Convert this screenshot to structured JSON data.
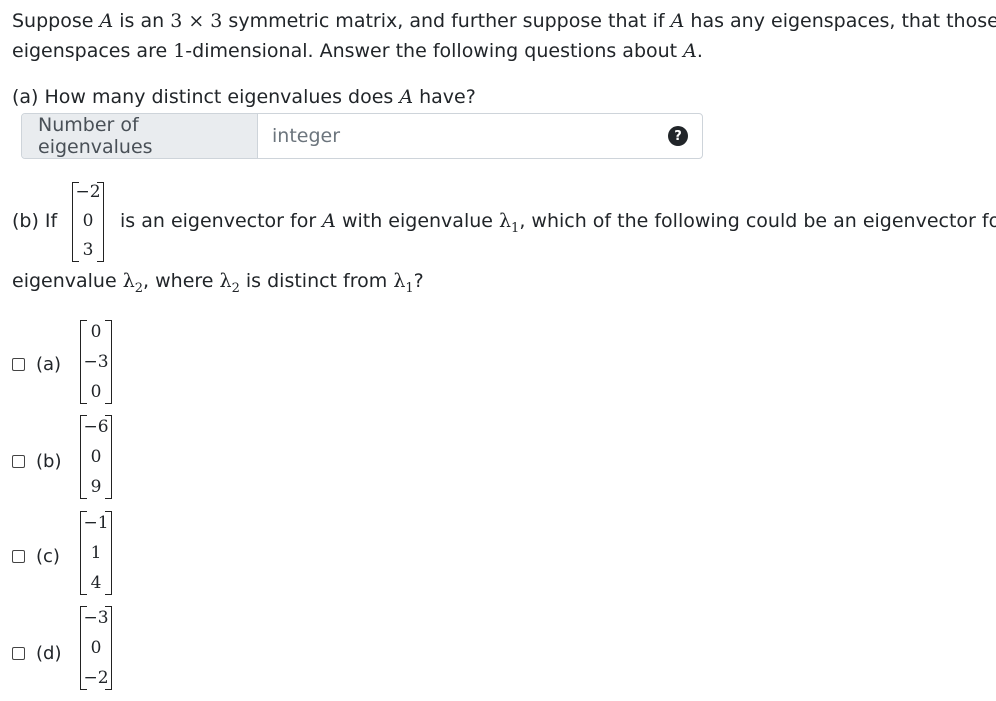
{
  "intro": {
    "line1_a": "Suppose ",
    "A": "A",
    "line1_b": " is an ",
    "dim": "3 × 3",
    "line1_c": " symmetric matrix, and further suppose that if ",
    "line1_d": " has any eigenspaces, that those",
    "line2_a": "eigenspaces are ",
    "one": "1",
    "line2_b": "-dimensional. Answer the following questions about ",
    "line2_c": "."
  },
  "part_a": {
    "question_a": "(a) How many distinct eigenvalues does ",
    "question_b": " have?",
    "label": "Number of eigenvalues",
    "placeholder": "integer",
    "value": "",
    "help": "?"
  },
  "part_b": {
    "prefix": "(b) If",
    "vector": [
      "−2",
      "0",
      "3"
    ],
    "text_a": "is an eigenvector for ",
    "text_b": " with eigenvalue ",
    "lambda": "λ",
    "sub1": "1",
    "text_c": ", which of the following could be an eigenvector for an",
    "line2_a": "eigenvalue ",
    "sub2": "2",
    "line2_b": ", where ",
    "line2_c": " is distinct from ",
    "line2_d": "?"
  },
  "options": [
    {
      "label": "(a)",
      "vector": [
        "0",
        "−3",
        "0"
      ],
      "checked": false
    },
    {
      "label": "(b)",
      "vector": [
        "−6",
        "0",
        "9"
      ],
      "checked": false
    },
    {
      "label": "(c)",
      "vector": [
        "−1",
        "1",
        "4"
      ],
      "checked": false
    },
    {
      "label": "(d)",
      "vector": [
        "−3",
        "0",
        "−2"
      ],
      "checked": false
    }
  ]
}
